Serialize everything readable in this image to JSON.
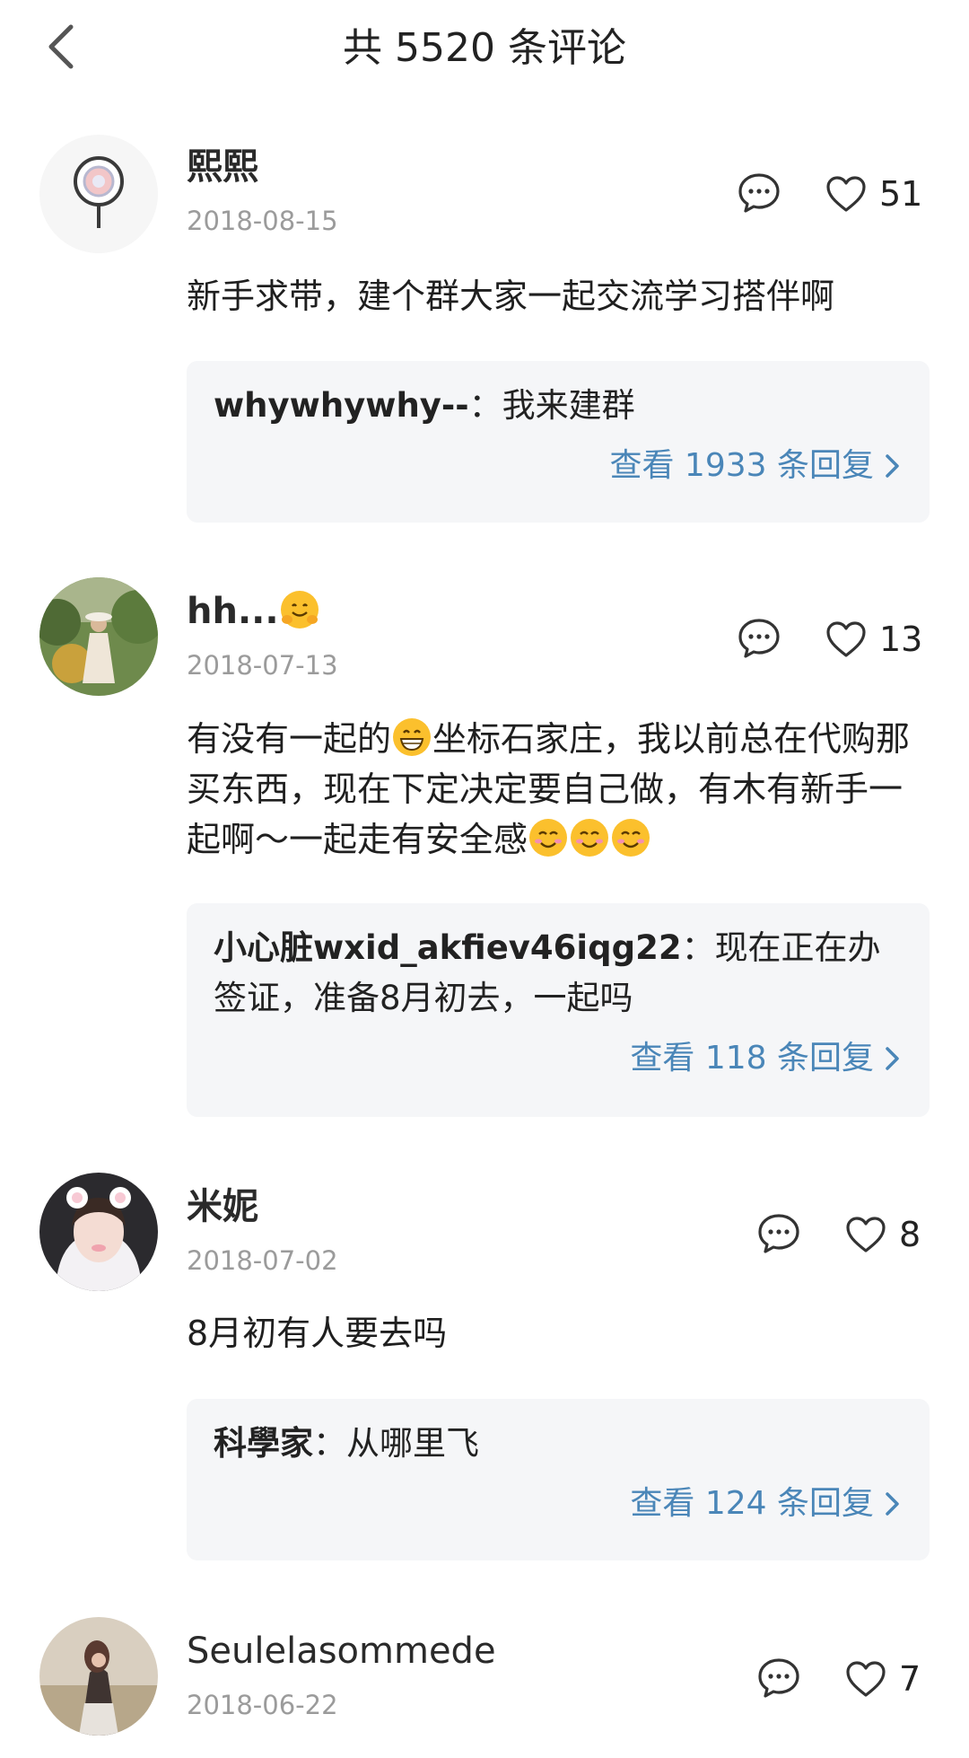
{
  "header": {
    "title": "共 5520 条评论"
  },
  "icons": {
    "back": "chevron-left-icon",
    "reply": "speech-bubble-icon",
    "like": "heart-outline-icon",
    "view_more": "chevron-right-icon",
    "emoji": "smiling-face-emoji"
  },
  "colors": {
    "link": "#4a86b8",
    "reply_bg": "#f5f6f8",
    "date": "#9b9b9b"
  },
  "comments": [
    {
      "username": "熙熙",
      "date": "2018-08-15",
      "likes": "51",
      "text": "新手求带，建个群大家一起交流学习搭伴啊",
      "reply": {
        "user": "whywhywhy--",
        "sep": "：",
        "text": "我来建群",
        "view_more": "查看 1933 条回复"
      }
    },
    {
      "username": "hh...",
      "date": "2018-07-13",
      "likes": "13",
      "text_a": "有没有一起的",
      "text_b": "坐标石家庄，我以前总在代购那买东西，现在下定决定要自己做，有木有新手一起啊～一起走有安全感",
      "reply": {
        "user": "小心脏wxid_akfiev46iqg22",
        "sep": "：",
        "text": "现在正在办签证，准备8月初去，一起吗",
        "view_more": "查看 118 条回复"
      }
    },
    {
      "username": "米妮",
      "date": "2018-07-02",
      "likes": "8",
      "text": "8月初有人要去吗",
      "reply": {
        "user": "科學家",
        "sep": "：",
        "text": "从哪里飞",
        "view_more": "查看 124 条回复"
      }
    },
    {
      "username": "Seulelasommede",
      "date": "2018-06-22",
      "likes": "7"
    }
  ]
}
